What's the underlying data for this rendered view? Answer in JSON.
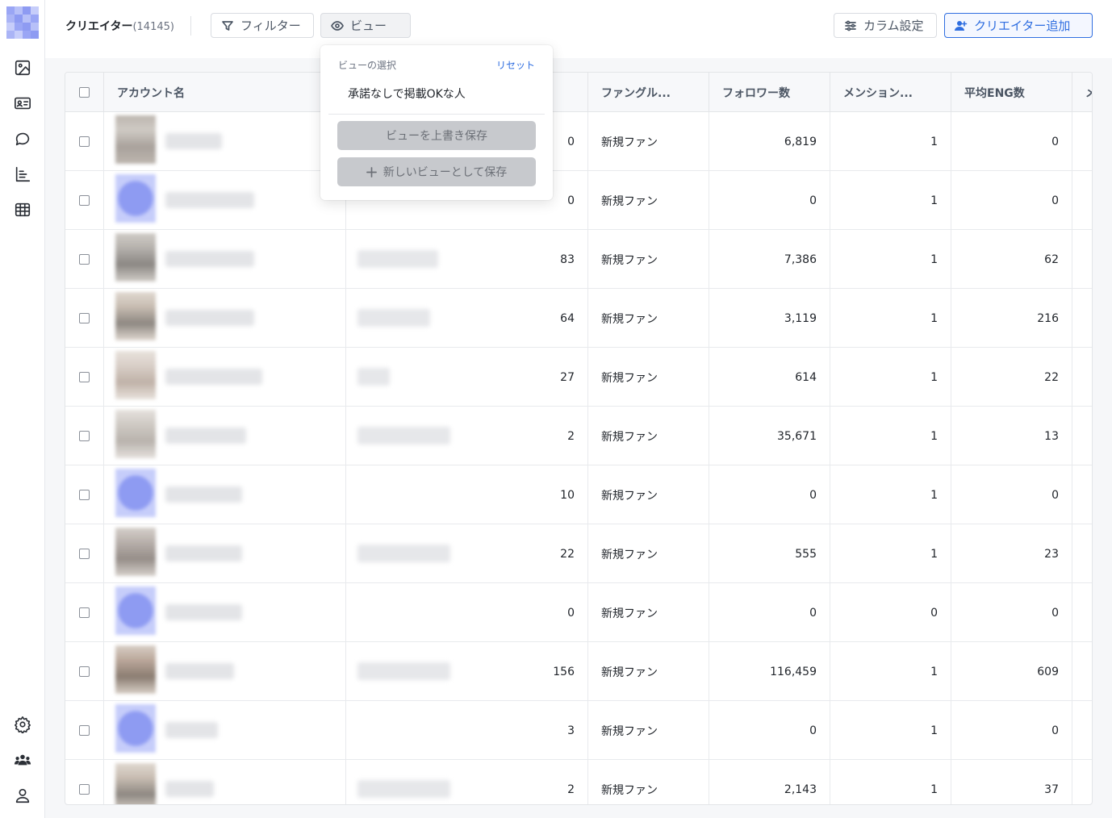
{
  "header": {
    "title": "クリエイター",
    "count": "(14145)",
    "filter_label": "フィルター",
    "view_label": "ビュー",
    "column_settings_label": "カラム設定",
    "add_creator_label": "クリエイター追加"
  },
  "view_menu": {
    "section_label": "ビューの選択",
    "reset_label": "リセット",
    "items": [
      "承諾なしで掲載OKな人"
    ],
    "overwrite_label": "ビューを上書き保存",
    "save_new_label": "新しいビューとして保存"
  },
  "table": {
    "columns": [
      "アカウント名",
      "ファングル...",
      "フォロワー数",
      "メンション...",
      "平均ENG数",
      "メ"
    ],
    "rows": [
      {
        "c1": "0",
        "group": "新規ファン",
        "followers": "6,819",
        "mentions": "1",
        "avg_eng": "0"
      },
      {
        "c1": "0",
        "group": "新規ファン",
        "followers": "0",
        "mentions": "1",
        "avg_eng": "0"
      },
      {
        "c1": "83",
        "group": "新規ファン",
        "followers": "7,386",
        "mentions": "1",
        "avg_eng": "62"
      },
      {
        "c1": "64",
        "group": "新規ファン",
        "followers": "3,119",
        "mentions": "1",
        "avg_eng": "216"
      },
      {
        "c1": "27",
        "group": "新規ファン",
        "followers": "614",
        "mentions": "1",
        "avg_eng": "22"
      },
      {
        "c1": "2",
        "group": "新規ファン",
        "followers": "35,671",
        "mentions": "1",
        "avg_eng": "13"
      },
      {
        "c1": "10",
        "group": "新規ファン",
        "followers": "0",
        "mentions": "1",
        "avg_eng": "0"
      },
      {
        "c1": "22",
        "group": "新規ファン",
        "followers": "555",
        "mentions": "1",
        "avg_eng": "23"
      },
      {
        "c1": "0",
        "group": "新規ファン",
        "followers": "0",
        "mentions": "0",
        "avg_eng": "0"
      },
      {
        "c1": "156",
        "group": "新規ファン",
        "followers": "116,459",
        "mentions": "1",
        "avg_eng": "609"
      },
      {
        "c1": "3",
        "group": "新規ファン",
        "followers": "0",
        "mentions": "1",
        "avg_eng": "0"
      },
      {
        "c1": "2",
        "group": "新規ファン",
        "followers": "2,143",
        "mentions": "1",
        "avg_eng": "37"
      }
    ]
  },
  "colors": {
    "accent": "#2f6ee0",
    "avatar_blue": "#9aa6f5",
    "avatar_gray": "#a9a29c"
  }
}
